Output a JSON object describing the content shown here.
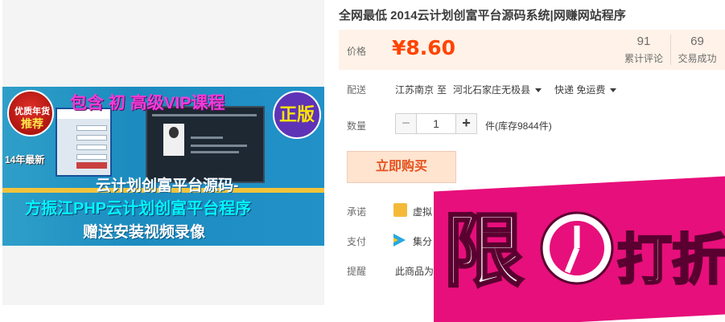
{
  "product": {
    "title": "全网最低 2014云计划创富平台源码系统|网赚网站程序"
  },
  "banner": {
    "badge_top": "优质年货",
    "badge_main": "推荐",
    "vip": "包含 初 高级VIP课程",
    "zheng": "正版",
    "year": "14年最新",
    "line1": "云计划创富平台源码-",
    "line2": "方振江PHP云计划创富平台程序",
    "line3": "赠送安装视频录像"
  },
  "price": {
    "label": "价格",
    "value": "¥8.60",
    "reviews_count": "91",
    "reviews_label": "累计评论",
    "deals_count": "69",
    "deals_label": "交易成功"
  },
  "shipping": {
    "label": "配送",
    "from": "江苏南京",
    "to_word": "至",
    "to": "河北石家庄无极县",
    "method": "快递 免运费"
  },
  "quantity": {
    "label": "数量",
    "minus": "−",
    "value": "1",
    "plus": "+",
    "stock": "件(库存9844件)"
  },
  "buy_button": "立即购买",
  "promise": {
    "label": "承诺",
    "text": "虚拟"
  },
  "payment": {
    "label": "支付",
    "text": "集分"
  },
  "reminder": {
    "label": "提醒",
    "text": "此商品为"
  },
  "promo": {
    "left": "限",
    "right": "打折"
  },
  "colors": {
    "price": "#ff4400",
    "promo": "#e70f7b",
    "buy_bg": "#ffe4d0"
  }
}
